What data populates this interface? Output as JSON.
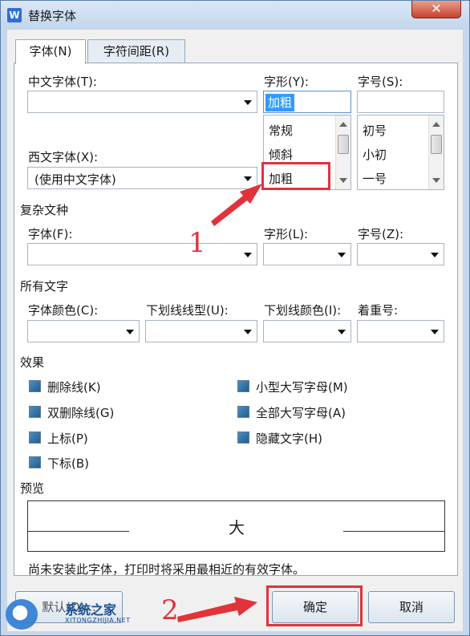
{
  "window": {
    "title": "替换字体",
    "app_icon": "W",
    "close_glyph": "✕"
  },
  "tabs": [
    {
      "label": "字体(N)",
      "active": true
    },
    {
      "label": "字符间距(R)",
      "active": false
    }
  ],
  "font": {
    "chinese_font_label": "中文字体(T):",
    "chinese_font_value": "",
    "style_label": "字形(Y):",
    "style_value": "加粗",
    "style_options": [
      "常规",
      "倾斜",
      "加粗"
    ],
    "size_label": "字号(S):",
    "size_value": "",
    "size_options": [
      "初号",
      "小初",
      "一号"
    ],
    "western_font_label": "西文字体(X):",
    "western_font_value": "(使用中文字体)"
  },
  "complex": {
    "section_label": "复杂文种",
    "font_label": "字体(F):",
    "style_label": "字形(L):",
    "size_label": "字号(Z):"
  },
  "all_text": {
    "section_label": "所有文字",
    "color_label": "字体颜色(C):",
    "underline_type_label": "下划线线型(U):",
    "underline_color_label": "下划线颜色(I):",
    "emphasis_label": "着重号:"
  },
  "effects": {
    "section_label": "效果",
    "items": [
      {
        "label": "删除线(K)"
      },
      {
        "label": "双删除线(G)"
      },
      {
        "label": "上标(P)"
      },
      {
        "label": "下标(B)"
      },
      {
        "label": "小型大写字母(M)"
      },
      {
        "label": "全部大写字母(A)"
      },
      {
        "label": "隐藏文字(H)"
      }
    ]
  },
  "preview": {
    "section_label": "预览",
    "sample": "大"
  },
  "notice": "尚未安装此字体，打印时将采用最相近的有效字体。",
  "buttons": {
    "default": "默认(D)...",
    "ok": "确定",
    "cancel": "取消"
  },
  "annotations": {
    "step1": "1",
    "step2": "2",
    "color": "#e2323a"
  },
  "watermark": {
    "name": "系统之家",
    "url": "XITONGZHIJIA.NET"
  }
}
